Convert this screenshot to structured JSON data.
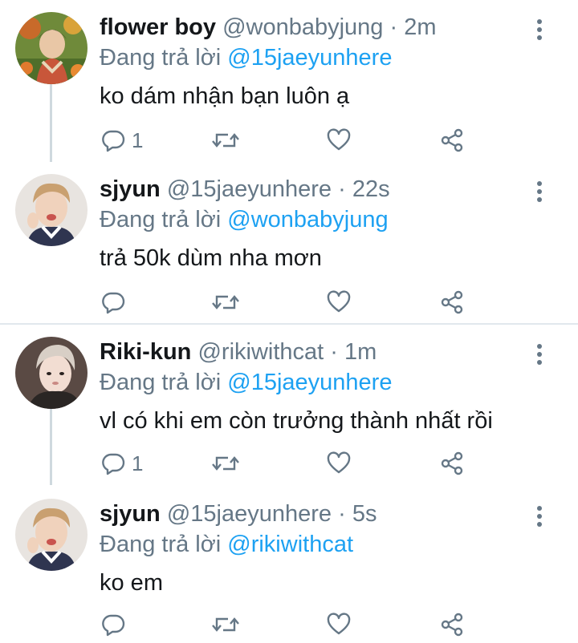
{
  "tweets": [
    {
      "name": "flower boy",
      "handle": "@wonbabyjung",
      "separator": "·",
      "time": "2m",
      "replying_label": "Đang trả lời",
      "replying_to": "@15jaeyunhere",
      "text": "ko dám nhận bạn luôn ạ",
      "reply_count": "1",
      "avatar": "flower-boy-avatar"
    },
    {
      "name": "sjyun",
      "handle": "@15jaeyunhere",
      "separator": "·",
      "time": "22s",
      "replying_label": "Đang trả lời",
      "replying_to": "@wonbabyjung",
      "text": "trả 50k dùm nha mơn",
      "reply_count": "",
      "avatar": "sjyun-avatar"
    },
    {
      "name": "Riki-kun",
      "handle": "@rikiwithcat",
      "separator": "·",
      "time": "1m",
      "replying_label": "Đang trả lời",
      "replying_to": "@15jaeyunhere",
      "text": "vl có khi em còn trưởng thành nhất rồi",
      "reply_count": "1",
      "avatar": "riki-avatar"
    },
    {
      "name": "sjyun",
      "handle": "@15jaeyunhere",
      "separator": "·",
      "time": "5s",
      "replying_label": "Đang trả lời",
      "replying_to": "@rikiwithcat",
      "text": "ko em",
      "reply_count": "",
      "avatar": "sjyun-avatar"
    }
  ],
  "icons": {
    "reply": "reply-icon",
    "retweet": "retweet-icon",
    "like": "like-icon",
    "share": "share-icon",
    "more": "more-icon"
  },
  "colors": {
    "link": "#1da1f2",
    "muted": "#657786",
    "text": "#14171a",
    "thread_line": "#cfd9de",
    "divider": "#e1e8ed"
  }
}
